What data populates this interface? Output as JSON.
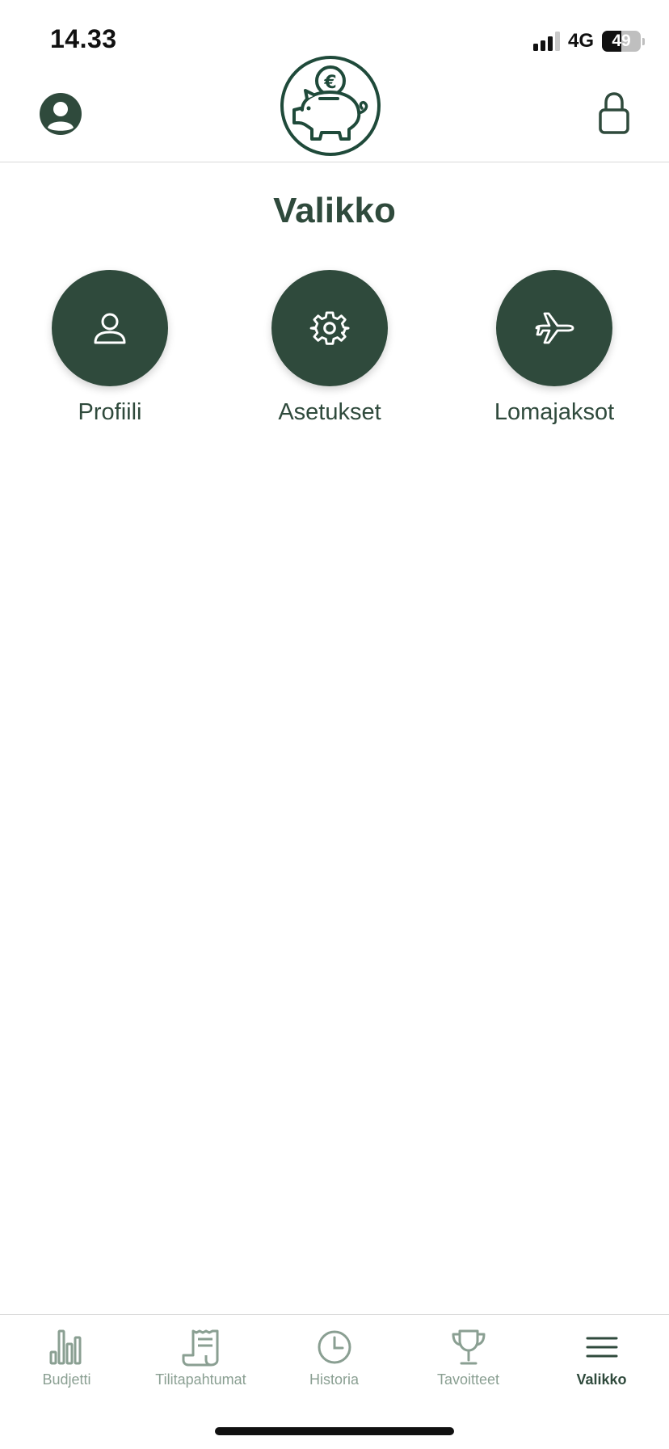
{
  "status_bar": {
    "time": "14.33",
    "network": "4G",
    "battery": {
      "label": "49",
      "level_percent": 49
    }
  },
  "header": {
    "logo_symbol": "€",
    "icons": {
      "profile": "user-circle-icon",
      "logo": "piggy-bank-icon",
      "lock": "lock-icon"
    }
  },
  "page": {
    "title": "Valikko"
  },
  "menu": {
    "items": [
      {
        "label": "Profiili",
        "icon": "user-icon"
      },
      {
        "label": "Asetukset",
        "icon": "gear-icon"
      },
      {
        "label": "Lomajaksot",
        "icon": "airplane-icon"
      }
    ]
  },
  "bottom_nav": {
    "items": [
      {
        "label": "Budjetti",
        "icon": "bar-chart-icon"
      },
      {
        "label": "Tilitapahtumat",
        "icon": "receipt-icon"
      },
      {
        "label": "Historia",
        "icon": "clock-icon"
      },
      {
        "label": "Tavoitteet",
        "icon": "trophy-icon"
      },
      {
        "label": "Valikko",
        "icon": "hamburger-menu-icon",
        "active": true
      }
    ]
  },
  "colors": {
    "primary": "#2f4a3c",
    "inactive": "#8a9f92",
    "divider": "#d9d9d9",
    "background": "#ffffff"
  }
}
